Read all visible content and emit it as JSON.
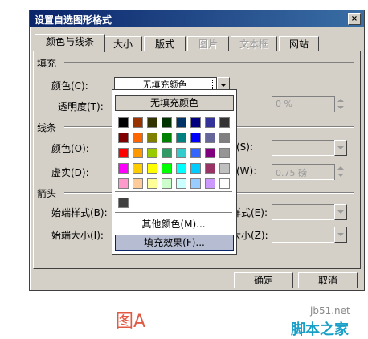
{
  "window": {
    "title": "设置自选图形格式",
    "close_label": "×"
  },
  "tabs": [
    {
      "label": "颜色与线条"
    },
    {
      "label": "大小"
    },
    {
      "label": "版式"
    },
    {
      "label": "图片"
    },
    {
      "label": "文本框"
    },
    {
      "label": "网站"
    }
  ],
  "fill": {
    "group_label": "填充",
    "color_label": "颜色(C):",
    "color_value": "无填充颜色",
    "transparency_label": "透明度(T):",
    "transparency_value": "0 %"
  },
  "line": {
    "group_label": "线条",
    "color_label": "颜色(O):",
    "dash_label": "虚实(D):",
    "style_label": "(S):",
    "weight_label": "(W):",
    "weight_value": "0.75 磅"
  },
  "arrows": {
    "group_label": "箭头",
    "begin_style_label": "始端样式(B):",
    "begin_size_label": "始端大小(I):",
    "end_style_label": "样式(E):",
    "end_size_label": "大小(Z):"
  },
  "popup": {
    "no_fill_label": "无填充颜色",
    "more_colors_label": "其他颜色(M)...",
    "fill_effects_label": "填充效果(F)...",
    "colors": [
      [
        "#000000",
        "#993300",
        "#333300",
        "#003300",
        "#003366",
        "#000080",
        "#333399",
        "#333333"
      ],
      [
        "#800000",
        "#ff6600",
        "#808000",
        "#008000",
        "#008080",
        "#0000ff",
        "#666699",
        "#808080"
      ],
      [
        "#ff0000",
        "#ff9900",
        "#99cc00",
        "#339966",
        "#33cccc",
        "#3366ff",
        "#800080",
        "#969696"
      ],
      [
        "#ff00ff",
        "#ffcc00",
        "#ffff00",
        "#00ff00",
        "#00ffff",
        "#00ccff",
        "#993366",
        "#c0c0c0"
      ],
      [
        "#ff99cc",
        "#ffcc99",
        "#ffff99",
        "#ccffcc",
        "#ccffff",
        "#99ccff",
        "#cc99ff",
        "#ffffff"
      ]
    ],
    "recent_color": "#404040"
  },
  "buttons": {
    "ok_label": "确定",
    "cancel_label": "取消"
  },
  "caption": "图A",
  "watermark": {
    "url": "jb51.net",
    "text": "脚本之家"
  }
}
